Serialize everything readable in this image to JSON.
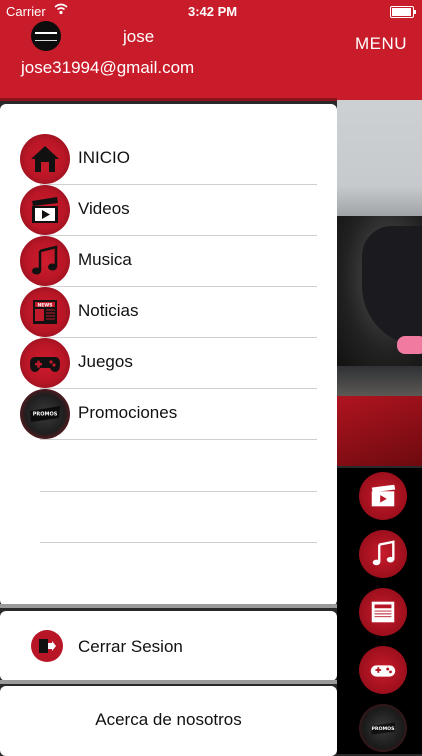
{
  "status_bar": {
    "carrier": "Carrier",
    "time": "3:42 PM"
  },
  "header": {
    "username": "jose",
    "email": "jose31994@gmail.com",
    "menu_label": "MENU",
    "brand_color": "#c91c2a"
  },
  "drawer": {
    "items": [
      {
        "label": "INICIO",
        "icon": "home-icon"
      },
      {
        "label": "Videos",
        "icon": "clapperboard-icon"
      },
      {
        "label": "Musica",
        "icon": "music-note-icon"
      },
      {
        "label": "Noticias",
        "icon": "newspaper-icon"
      },
      {
        "label": "Juegos",
        "icon": "gamepad-icon"
      },
      {
        "label": "Promociones",
        "icon": "promos-icon"
      }
    ],
    "logout_label": "Cerrar Sesion",
    "about_label": "Acerca de nosotros"
  },
  "background_tiles": [
    "clapperboard-icon",
    "music-note-icon",
    "newspaper-icon",
    "gamepad-icon",
    "promos-icon"
  ]
}
